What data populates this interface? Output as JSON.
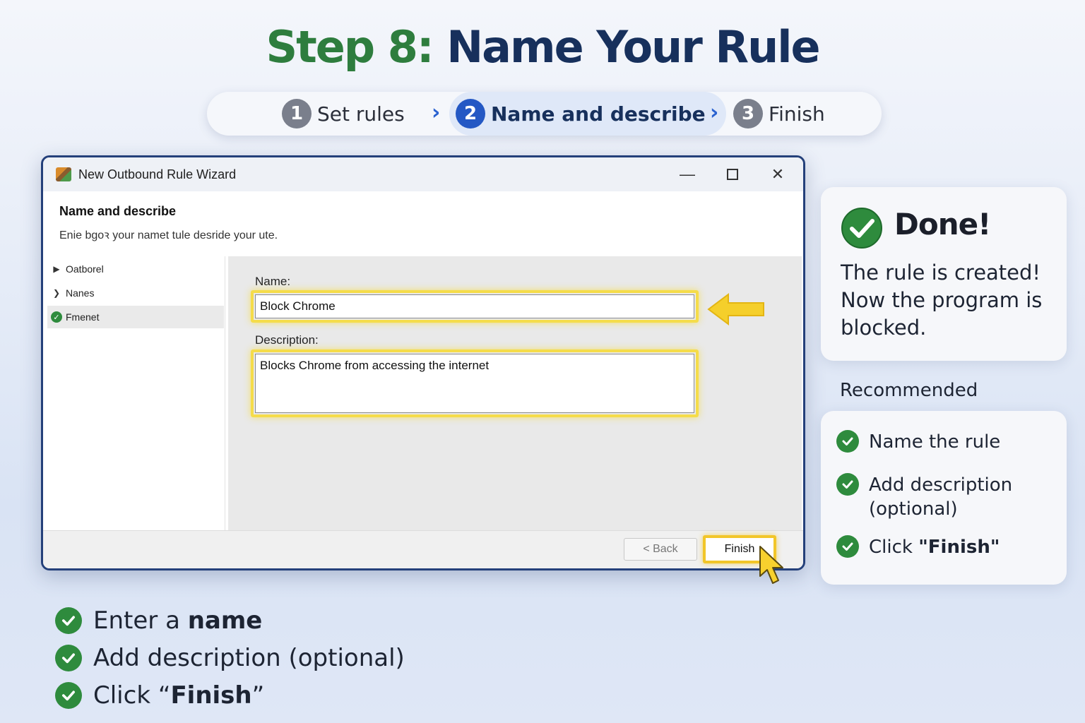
{
  "heading": {
    "prefix": "Step 8:",
    "main": "Name Your Rule"
  },
  "steps": [
    {
      "number": "1",
      "label": "Set rules"
    },
    {
      "number": "2",
      "label": "Name and describe"
    },
    {
      "number": "3",
      "label": "Finish"
    }
  ],
  "window": {
    "title": "New Outbound Rule Wizard",
    "controls": {
      "minimize": "—",
      "close": "✕"
    },
    "page_title": "Name and describe",
    "page_subtitle": "Enie bgoꝛ your namet tule desride your ute.",
    "nav": [
      {
        "label": "Oatborel",
        "state": "done-arrow"
      },
      {
        "label": "Nanes",
        "state": "done-arrow"
      },
      {
        "label": "Fmenet",
        "state": "current-check"
      }
    ],
    "name_label": "Name:",
    "name_value": "Block Chrome",
    "description_label": "Description:",
    "description_value": "Blocks Chrome from accessing the internet",
    "back_button": "< Back",
    "finish_button": "Finish"
  },
  "done_card": {
    "title": "Done!",
    "text": "The rule is created! Now the program is blocked."
  },
  "recommended": {
    "title": "Recommended",
    "items": [
      {
        "text": "Name the rule",
        "bold": ""
      },
      {
        "text": "Add description (optional)",
        "bold": ""
      },
      {
        "text": "Click ",
        "bold": "\"Finish\""
      }
    ]
  },
  "bottom_list": [
    {
      "text": "Enter a ",
      "bold": "name"
    },
    {
      "text": "Add description (optional)",
      "bold": ""
    },
    {
      "text": "Click “",
      "bold": "Finish",
      "suffix": "”"
    }
  ],
  "colors": {
    "title_green": "#2e7d3e",
    "title_navy": "#17305c",
    "accent_blue": "#2458c4",
    "check_green": "#2e8b3d",
    "highlight_yellow": "#f5dc4a"
  }
}
